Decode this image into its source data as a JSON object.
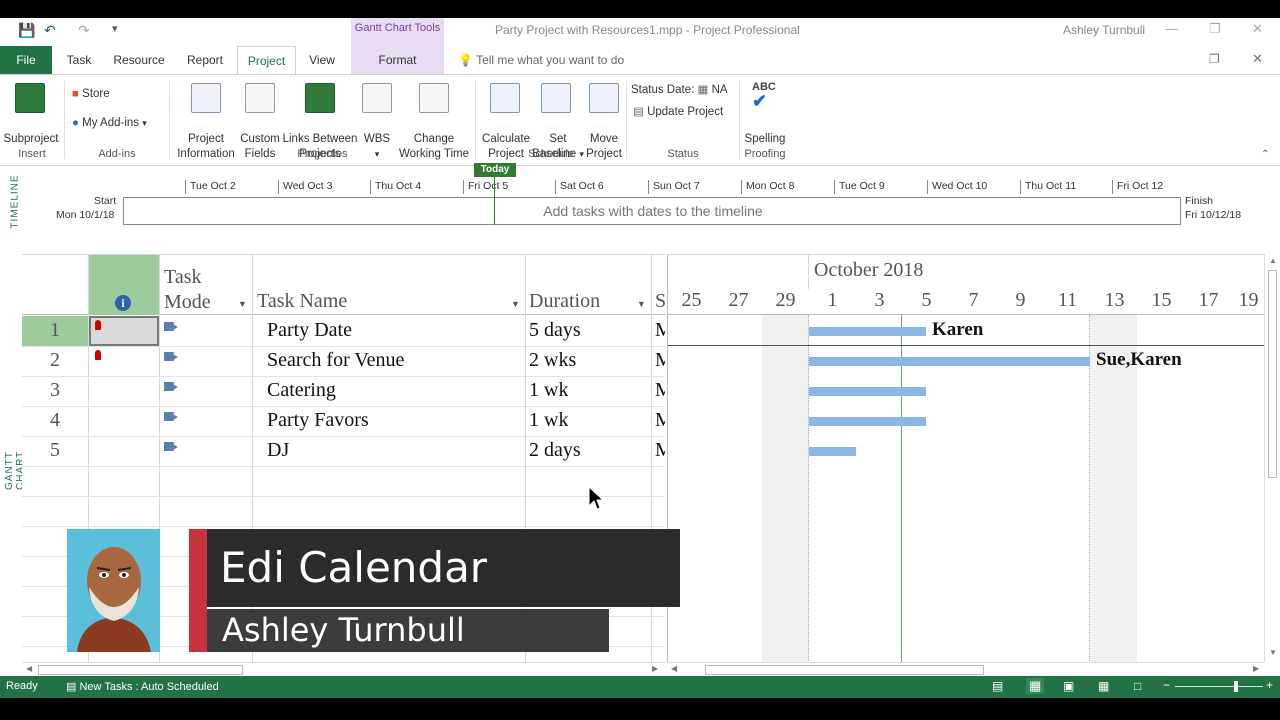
{
  "window": {
    "title": "Party Project with Resources1.mpp  -  Project Professional",
    "context_tab": "Gantt Chart Tools",
    "user": "Ashley Turnbull",
    "minimize": "—",
    "restore": "❐",
    "close": "✕"
  },
  "tabs": [
    "File",
    "Task",
    "Resource",
    "Report",
    "Project",
    "View",
    "Format"
  ],
  "active_tab": "Project",
  "tell_me": "Tell me what you want to do",
  "ribbon": {
    "insert": {
      "subproject": "Subproject",
      "group": "Insert"
    },
    "addins": {
      "store": "Store",
      "my_addins": "My Add-ins",
      "group": "Add-ins"
    },
    "properties": {
      "project_info": [
        "Project",
        "Information"
      ],
      "custom_fields": [
        "Custom",
        "Fields"
      ],
      "links": [
        "Links Between",
        "Projects"
      ],
      "wbs": "WBS",
      "change_time": [
        "Change",
        "Working Time"
      ],
      "group": "Properties"
    },
    "schedule": {
      "calculate": [
        "Calculate",
        "Project"
      ],
      "set_baseline": [
        "Set",
        "Baseline"
      ],
      "move": [
        "Move",
        "Project"
      ],
      "group": "Schedule"
    },
    "status": {
      "status_date_label": "Status Date:",
      "status_date_value": "NA",
      "update": "Update Project",
      "group": "Status"
    },
    "proofing": {
      "abc": "ABC",
      "spelling": "Spelling",
      "group": "Proofing"
    }
  },
  "timeline": {
    "label": "TIMELINE",
    "start_label": "Start",
    "start_date": "Mon 10/1/18",
    "finish_label": "Finish",
    "finish_date": "Fri 10/12/18",
    "today": "Today",
    "message": "Add tasks with dates to the timeline",
    "ticks": [
      "Tue Oct 2",
      "Wed Oct 3",
      "Thu Oct 4",
      "Fri Oct 5",
      "Sat Oct 6",
      "Sun Oct 7",
      "Mon Oct 8",
      "Tue Oct 9",
      "Wed Oct 10",
      "Thu Oct 11",
      "Fri Oct 12"
    ]
  },
  "grid": {
    "vlabel": "GANTT CHART",
    "headers": {
      "info": "i",
      "mode": [
        "Task",
        "Mode"
      ],
      "name": "Task Name",
      "duration": "Duration",
      "start": "S"
    },
    "rows": [
      {
        "id": "1",
        "name": "Party Date",
        "duration": "5 days",
        "start": "M",
        "pin": true
      },
      {
        "id": "2",
        "name": "Search for Venue",
        "duration": "2 wks",
        "start": "M",
        "pin": true
      },
      {
        "id": "3",
        "name": "Catering",
        "duration": "1 wk",
        "start": "M",
        "pin": false
      },
      {
        "id": "4",
        "name": "Party Favors",
        "duration": "1 wk",
        "start": "M",
        "pin": false
      },
      {
        "id": "5",
        "name": "DJ",
        "duration": "2 days",
        "start": "M",
        "pin": false
      }
    ]
  },
  "chart": {
    "month": "October 2018",
    "dates": [
      "25",
      "27",
      "29",
      "1",
      "3",
      "5",
      "7",
      "9",
      "11",
      "13",
      "15",
      "17",
      "19"
    ],
    "bars": [
      {
        "row": 1,
        "label": "Karen"
      },
      {
        "row": 2,
        "label": "Sue,Karen"
      },
      {
        "row": 3,
        "label": ""
      },
      {
        "row": 4,
        "label": ""
      },
      {
        "row": 5,
        "label": ""
      }
    ]
  },
  "overlay": {
    "title": "Edi Calendar",
    "name": "Ashley Turnbull"
  },
  "status": {
    "ready": "Ready",
    "new_tasks": "New Tasks : Auto Scheduled"
  },
  "colors": {
    "accent": "#217346",
    "bar": "#8cb6e3",
    "context": "#e8dcf3",
    "lower_third_red": "#c8343b"
  }
}
